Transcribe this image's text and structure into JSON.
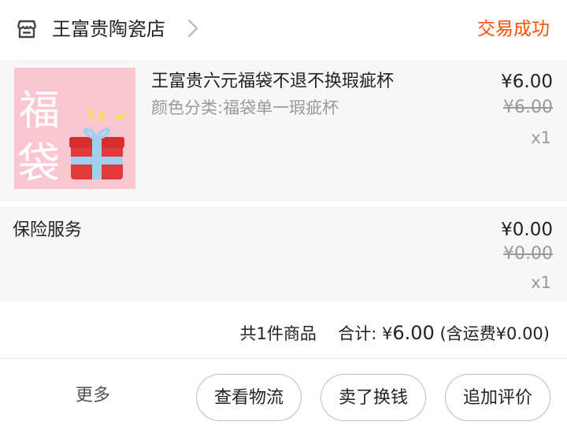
{
  "header": {
    "shop_name": "王富贵陶瓷店",
    "order_status": "交易成功",
    "icons": {
      "shop": "shop-icon",
      "chevron": "chevron-right-icon"
    },
    "accent_color": "#ff5000"
  },
  "item": {
    "title": "王富贵六元福袋不退不换瑕疵杯",
    "sku": "颜色分类:福袋单一瑕疵杯",
    "price": "¥6.00",
    "original_price": "¥6.00",
    "quantity": "x1",
    "thumbnail": {
      "text": [
        "福",
        "袋"
      ],
      "icon": "gift-box-icon"
    }
  },
  "insurance": {
    "label": "保险服务",
    "price": "¥0.00",
    "original_price": "¥0.00",
    "quantity": "x1"
  },
  "summary": {
    "count_text": "共1件商品",
    "total_label": "合计:",
    "currency": "¥",
    "total_amount": "6.00",
    "shipping": "(含运费¥0.00)"
  },
  "actions": {
    "more": "更多",
    "logistics": "查看物流",
    "resell": "卖了换钱",
    "review": "追加评价"
  }
}
